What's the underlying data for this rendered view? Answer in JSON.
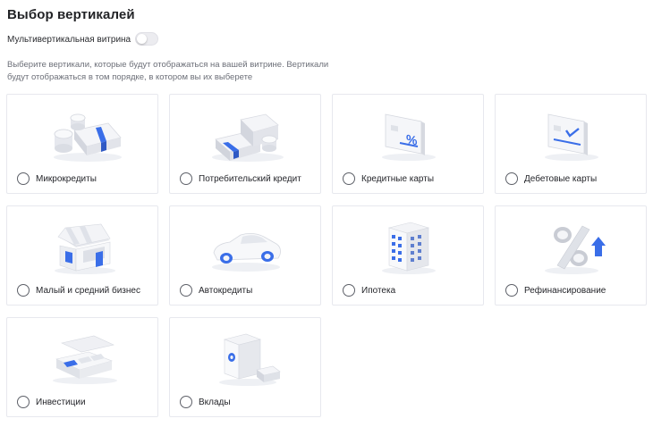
{
  "page": {
    "title": "Выбор вертикалей",
    "toggle_label": "Мультивертикальная витрина",
    "toggle_on": false,
    "description": "Выберите вертикали, которые будут отображаться на вашей витрине. Вертикали будут отображаться в том порядке, в котором вы их выберете"
  },
  "colors": {
    "accent": "#3a6ee8",
    "border": "#e7e8ee",
    "text_muted": "#6c6f78"
  },
  "verticals": [
    {
      "label": "Микрокредиты",
      "icon": "coins-banknotes-icon",
      "selected": false
    },
    {
      "label": "Потребительский кредит",
      "icon": "banknote-stack-icon",
      "selected": false
    },
    {
      "label": "Кредитные карты",
      "icon": "credit-card-percent-icon",
      "selected": false
    },
    {
      "label": "Дебетовые карты",
      "icon": "debit-card-check-icon",
      "selected": false
    },
    {
      "label": "Малый и средний бизнес",
      "icon": "shop-storefront-icon",
      "selected": false
    },
    {
      "label": "Автокредиты",
      "icon": "car-icon",
      "selected": false
    },
    {
      "label": "Ипотека",
      "icon": "apartment-building-icon",
      "selected": false
    },
    {
      "label": "Рефинансирование",
      "icon": "percent-refinance-icon",
      "selected": false
    },
    {
      "label": "Инвестиции",
      "icon": "briefcase-investment-icon",
      "selected": false
    },
    {
      "label": "Вклады",
      "icon": "safe-deposit-icon",
      "selected": false
    }
  ]
}
